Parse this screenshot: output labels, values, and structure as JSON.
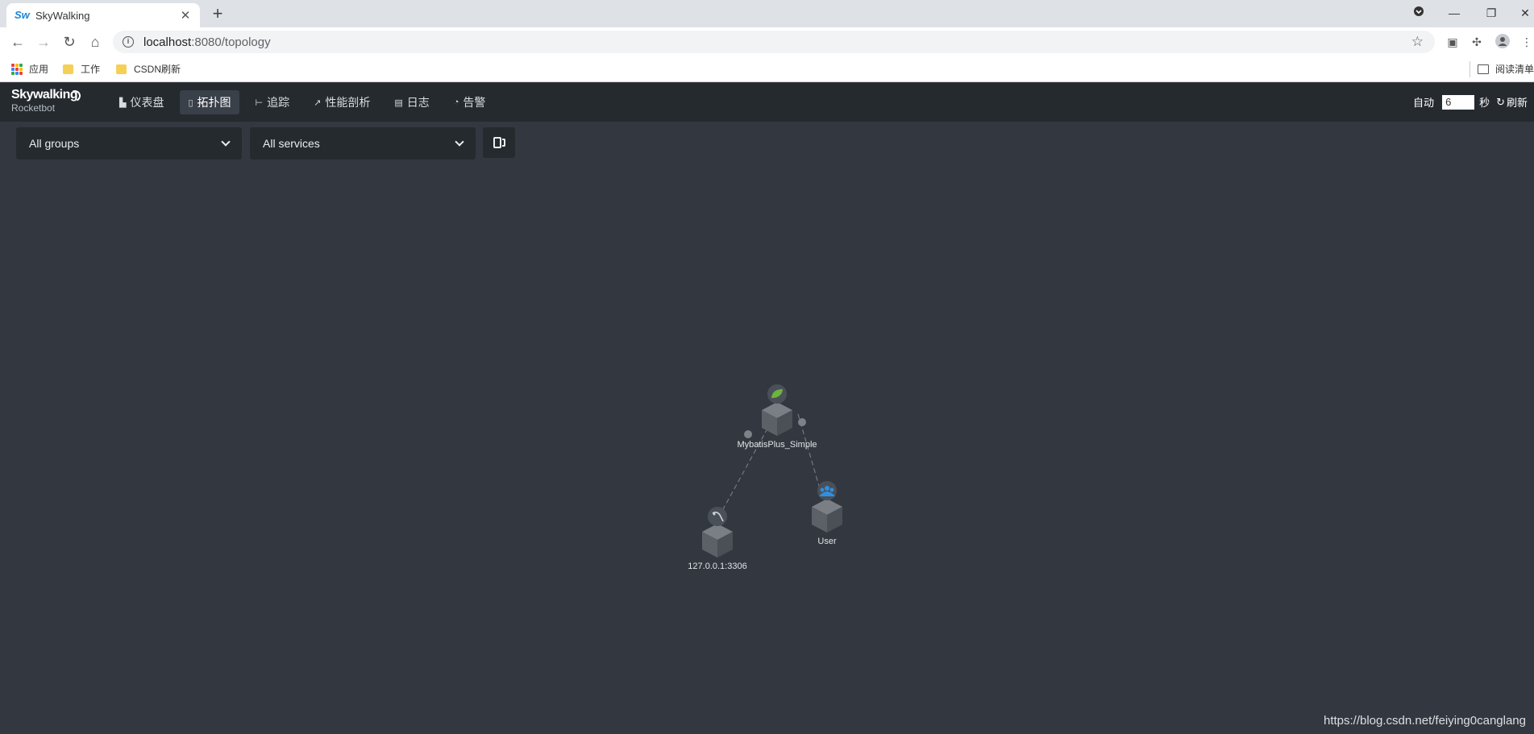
{
  "browser": {
    "tab_title": "SkyWalking",
    "tab_favicon": "Sw",
    "url_host": "localhost",
    "url_path": ":8080/topology",
    "bookmarks": [
      {
        "label": "应用",
        "icon": "apps-grid-icon"
      },
      {
        "label": "工作",
        "icon": "folder-icon"
      },
      {
        "label": "CSDN刷新",
        "icon": "folder-icon"
      }
    ],
    "reading_list": "阅读清单"
  },
  "app": {
    "logo_main": "Skywalking",
    "logo_sub": "Rocketbot",
    "nav": [
      {
        "label": "仪表盘",
        "icon": "dashboard-icon",
        "glyph": "📊",
        "active": false
      },
      {
        "label": "拓扑图",
        "icon": "topology-icon",
        "glyph": "▯",
        "active": true
      },
      {
        "label": "追踪",
        "icon": "trace-icon",
        "glyph": "⊦",
        "active": false
      },
      {
        "label": "性能剖析",
        "icon": "profile-icon",
        "glyph": "↗",
        "active": false
      },
      {
        "label": "日志",
        "icon": "log-icon",
        "glyph": "▤",
        "active": false
      },
      {
        "label": "告警",
        "icon": "alarm-icon",
        "glyph": "◔",
        "active": false
      }
    ],
    "auto_label": "自动",
    "interval_value": "6",
    "seconds_label": "秒",
    "refresh_label": "刷新"
  },
  "filters": {
    "group_select": "All groups",
    "service_select": "All services"
  },
  "topology": {
    "nodes": [
      {
        "name": "MybatisPlus_Simple",
        "type": "spring-service",
        "badge_color": "#6db33f"
      },
      {
        "name": "127.0.0.1:3306",
        "type": "mysql-database",
        "badge_color": "#4a5058"
      },
      {
        "name": "User",
        "type": "user",
        "badge_color": "#2f8fe0"
      }
    ],
    "edges": [
      {
        "from": "MybatisPlus_Simple",
        "to": "127.0.0.1:3306"
      },
      {
        "from": "User",
        "to": "MybatisPlus_Simple"
      }
    ]
  },
  "watermark": "https://blog.csdn.net/feiying0canglang"
}
